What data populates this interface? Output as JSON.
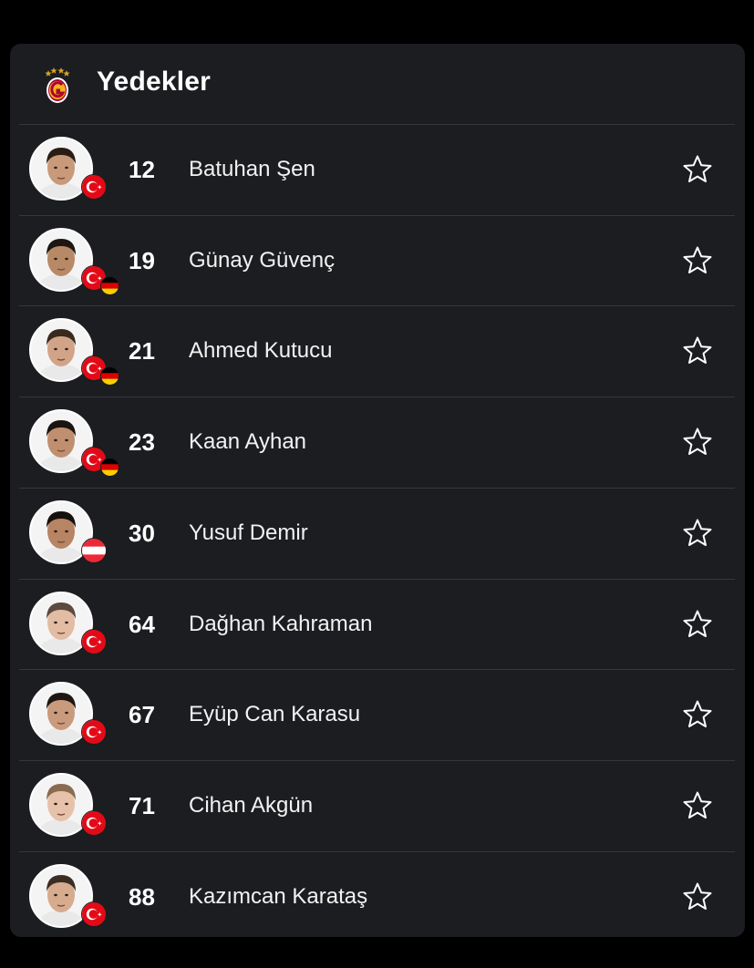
{
  "header": {
    "title": "Yedekler",
    "logo_icon": "galatasaray-crest-icon"
  },
  "colors": {
    "background": "#000000",
    "card": "#1b1d20",
    "divider": "#34373c",
    "text": "#ffffff",
    "turkey_red": "#e30a17"
  },
  "players": [
    {
      "number": "12",
      "name": "Batuhan Şen",
      "flags": [
        "turkey"
      ]
    },
    {
      "number": "19",
      "name": "Günay Güvenç",
      "flags": [
        "turkey",
        "germany"
      ]
    },
    {
      "number": "21",
      "name": "Ahmed Kutucu",
      "flags": [
        "turkey",
        "germany"
      ]
    },
    {
      "number": "23",
      "name": "Kaan Ayhan",
      "flags": [
        "turkey",
        "germany"
      ]
    },
    {
      "number": "30",
      "name": "Yusuf Demir",
      "flags": [
        "austria"
      ]
    },
    {
      "number": "64",
      "name": "Dağhan Kahraman",
      "flags": [
        "turkey"
      ]
    },
    {
      "number": "67",
      "name": "Eyüp Can Karasu",
      "flags": [
        "turkey"
      ]
    },
    {
      "number": "71",
      "name": "Cihan Akgün",
      "flags": [
        "turkey"
      ]
    },
    {
      "number": "88",
      "name": "Kazımcan Karataş",
      "flags": [
        "turkey"
      ]
    }
  ]
}
